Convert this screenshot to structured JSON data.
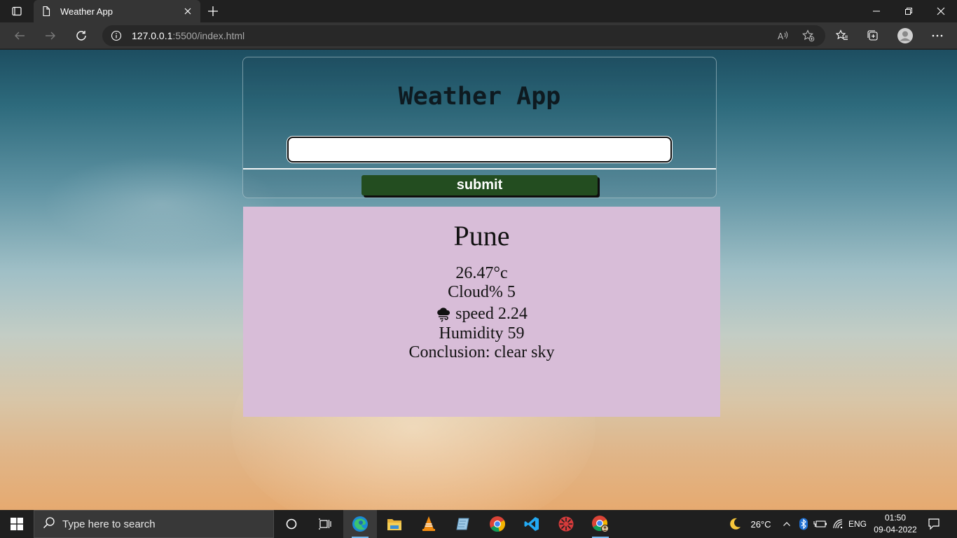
{
  "browser": {
    "tab_title": "Weather App",
    "url_host": "127.0.0.1",
    "url_rest": ":5500/index.html"
  },
  "app": {
    "title": "Weather App",
    "input_value": "",
    "submit_label": "submit"
  },
  "result": {
    "city": "Pune",
    "temperature": "26.47°c",
    "cloud": "Cloud% 5",
    "wind": "speed 2.24",
    "humidity": "Humidity 59",
    "conclusion": "Conclusion: clear sky"
  },
  "taskbar": {
    "search_placeholder": "Type here to search",
    "weather_temp": "26°C",
    "language": "ENG",
    "time": "01:50",
    "date": "09-04-2022",
    "pinned_apps": [
      "edge-icon",
      "file-explorer-icon",
      "vlc-icon",
      "notepad-icon",
      "chrome-icon",
      "vscode-icon",
      "app-icon",
      "chrome-profile-icon"
    ]
  },
  "colors": {
    "submit_bg": "#234d20",
    "result_bg": "#d8bdd8",
    "taskbar_accent": "#76b9ed"
  }
}
